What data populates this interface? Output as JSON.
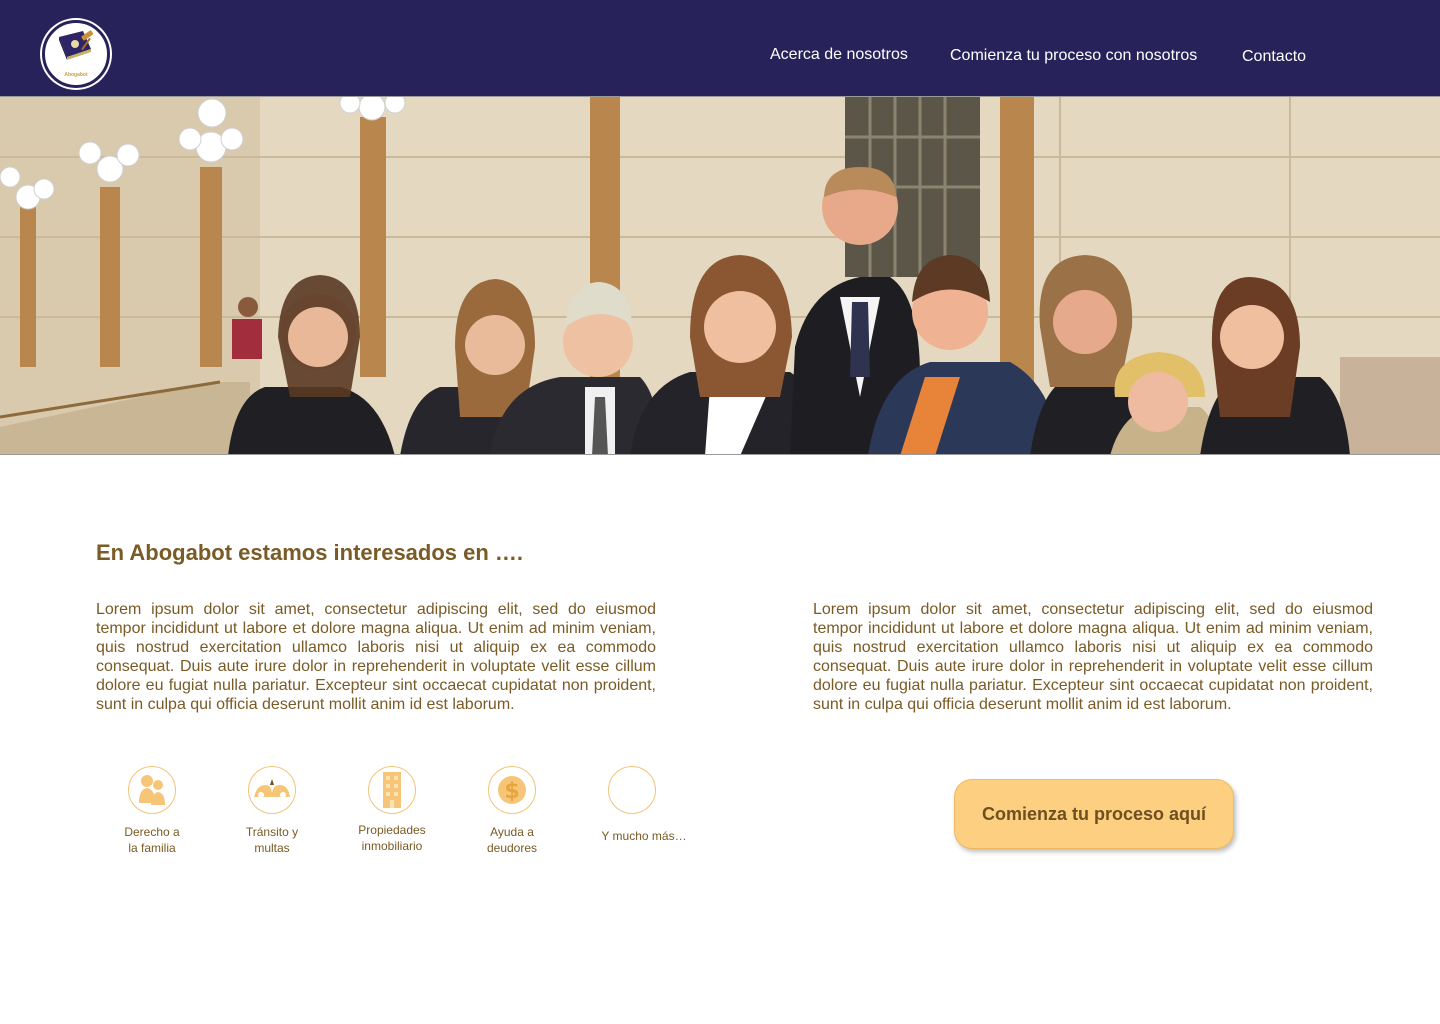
{
  "header": {
    "logo_text": "Abogabot",
    "nav": [
      "Acerca de nosotros",
      "Comienza tu proceso con nosotros",
      "Contacto"
    ]
  },
  "hero": {
    "image_icon": "team-photo"
  },
  "main": {
    "heading": "En Abogabot estamos interesados en ….",
    "paragraph_left": "Lorem ipsum dolor sit amet, consectetur adipiscing elit, sed do eiusmod tempor incididunt ut labore et dolore magna aliqua. Ut enim ad minim veniam, quis nostrud exercitation ullamco laboris nisi ut aliquip ex ea commodo consequat. Duis aute irure dolor in reprehenderit in voluptate velit esse cillum dolore eu fugiat nulla pariatur. Excepteur sint occaecat cupidatat non proident, sunt in culpa qui officia deserunt mollit anim id est laborum.",
    "paragraph_right": "Lorem ipsum dolor sit amet, consectetur adipiscing elit, sed do eiusmod tempor incididunt ut labore et dolore magna aliqua. Ut enim ad minim veniam, quis nostrud exercitation ullamco laboris nisi ut aliquip ex ea commodo consequat. Duis aute irure dolor in reprehenderit in voluptate velit esse cillum dolore eu fugiat nulla pariatur. Excepteur sint occaecat cupidatat non proident, sunt in culpa qui officia deserunt mollit anim id est laborum.",
    "services": [
      {
        "label": "Derecho a\nla familia",
        "icon": "family-icon"
      },
      {
        "label": "Tránsito y\nmultas",
        "icon": "traffic-icon"
      },
      {
        "label": "Propiedades\ninmobiliario",
        "icon": "building-icon"
      },
      {
        "label": "Ayuda a\ndeudores",
        "icon": "dollar-icon"
      },
      {
        "label": "Y mucho más…",
        "icon": "empty-icon"
      }
    ],
    "cta_label": "Comienza tu proceso aquí"
  },
  "colors": {
    "header_bg": "#28225a",
    "text_brown": "#7a5a25",
    "accent_gold": "#fdd081"
  }
}
